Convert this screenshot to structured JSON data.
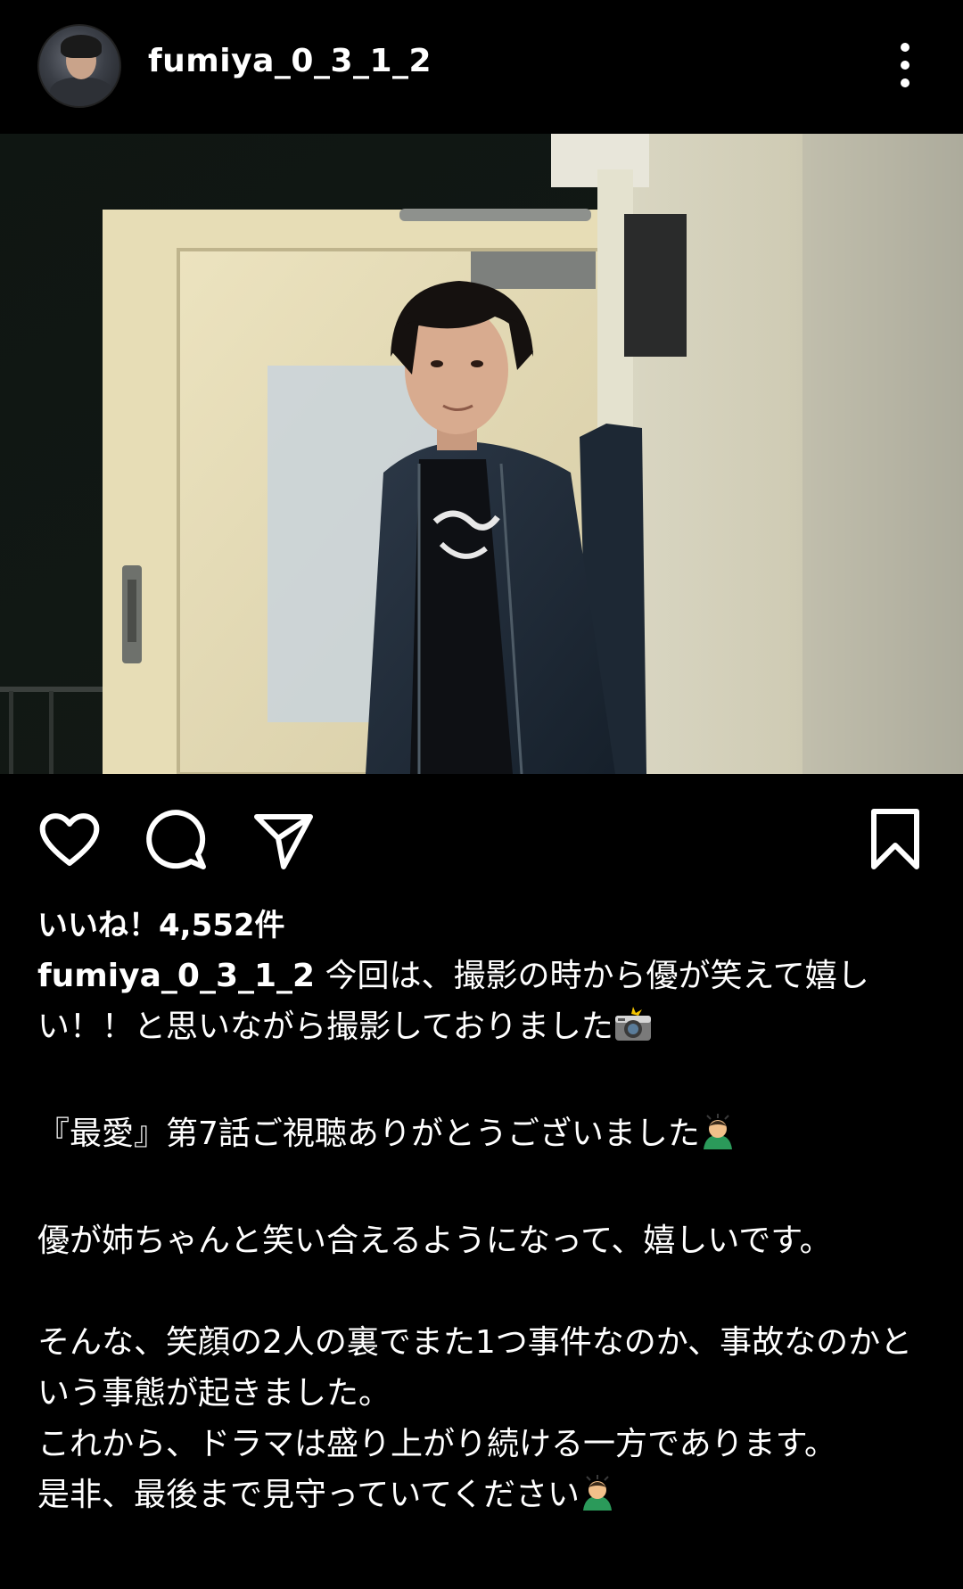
{
  "post": {
    "username": "fumiya_0_3_1_2",
    "likes_text": "いいね！4,552件"
  },
  "caption": {
    "username": "fumiya_0_3_1_2",
    "first_text": " 今回は、撮影の時から優が笑えて嬉しい！！と思いながら撮影しておりました",
    "line2": "『最愛』第7話ご視聴ありがとうございました",
    "line3": "優が姉ちゃんと笑い合えるようになって、嬉しいです。",
    "line4": "そんな、笑顔の2人の裏でまた1つ事件なのか、事故なのかという事態が起きました。",
    "line5": "これから、ドラマは盛り上がり続ける一方であります。",
    "line6": "是非、最後まで見守っていてください"
  },
  "icons": {
    "more": "more-vertical-icon",
    "like": "heart-icon",
    "comment": "comment-icon",
    "share": "send-icon",
    "save": "bookmark-icon",
    "camera_emoji": "camera-flash-emoji",
    "bow_emoji": "person-bowing-emoji"
  }
}
